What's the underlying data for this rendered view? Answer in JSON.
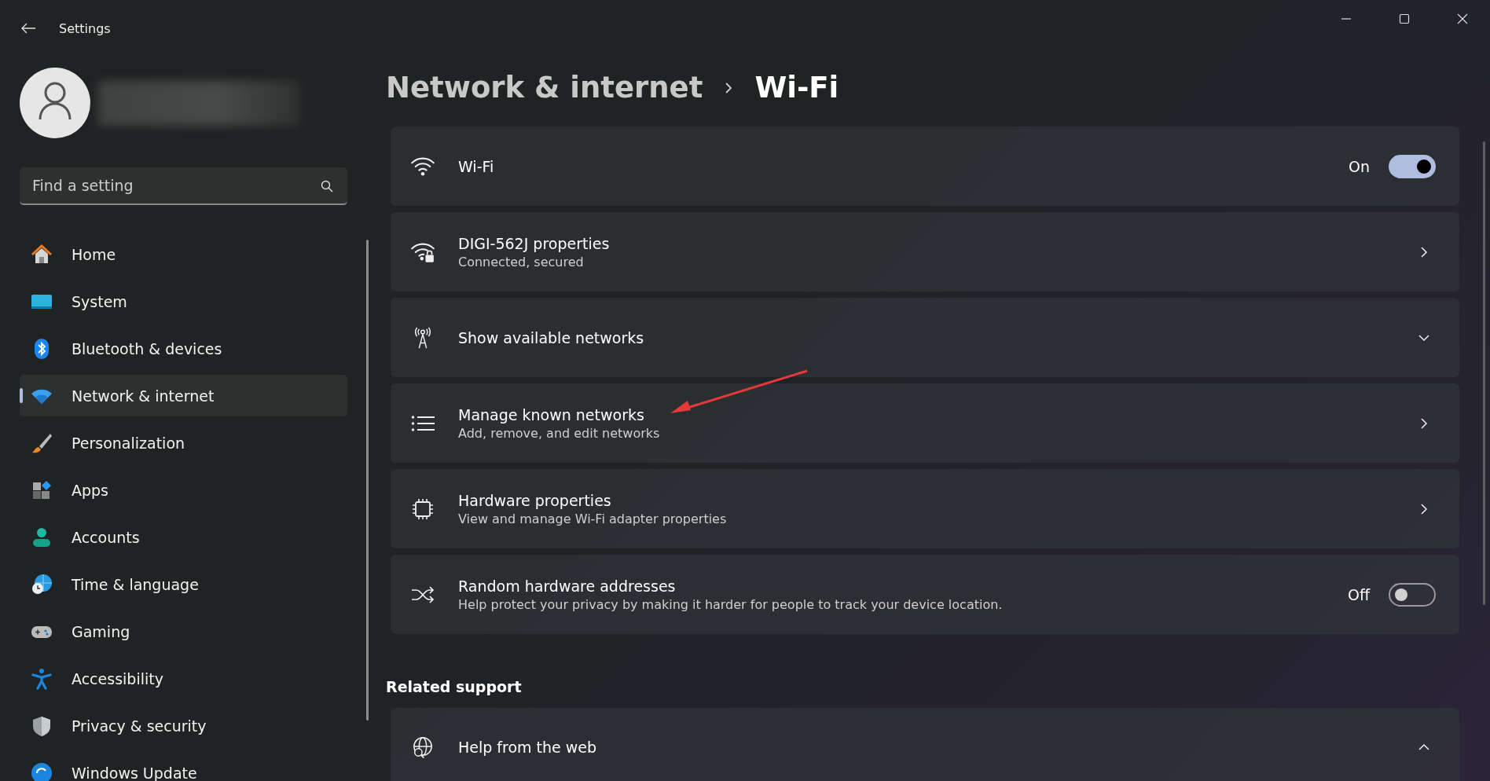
{
  "window": {
    "title": "Settings"
  },
  "search": {
    "placeholder": "Find a setting"
  },
  "nav": [
    {
      "label": "Home",
      "selected": false
    },
    {
      "label": "System",
      "selected": false
    },
    {
      "label": "Bluetooth & devices",
      "selected": false
    },
    {
      "label": "Network & internet",
      "selected": true
    },
    {
      "label": "Personalization",
      "selected": false
    },
    {
      "label": "Apps",
      "selected": false
    },
    {
      "label": "Accounts",
      "selected": false
    },
    {
      "label": "Time & language",
      "selected": false
    },
    {
      "label": "Gaming",
      "selected": false
    },
    {
      "label": "Accessibility",
      "selected": false
    },
    {
      "label": "Privacy & security",
      "selected": false
    },
    {
      "label": "Windows Update",
      "selected": false
    }
  ],
  "breadcrumb": [
    "Network & internet",
    "Wi-Fi"
  ],
  "settings": [
    {
      "kind": "toggle",
      "title": "Wi-Fi",
      "state_label": "On",
      "on": true
    },
    {
      "kind": "link",
      "title": "DIGI-562J properties",
      "subtitle": "Connected, secured"
    },
    {
      "kind": "expander",
      "title": "Show available networks",
      "expanded": false
    },
    {
      "kind": "link",
      "title": "Manage known networks",
      "subtitle": "Add, remove, and edit networks"
    },
    {
      "kind": "link",
      "title": "Hardware properties",
      "subtitle": "View and manage Wi-Fi adapter properties"
    },
    {
      "kind": "toggle",
      "title": "Random hardware addresses",
      "subtitle": "Help protect your privacy by making it harder for people to track your device location.",
      "state_label": "Off",
      "on": false
    }
  ],
  "related_support": {
    "heading": "Related support",
    "items": [
      {
        "title": "Help from the web",
        "expanded": true
      }
    ]
  }
}
